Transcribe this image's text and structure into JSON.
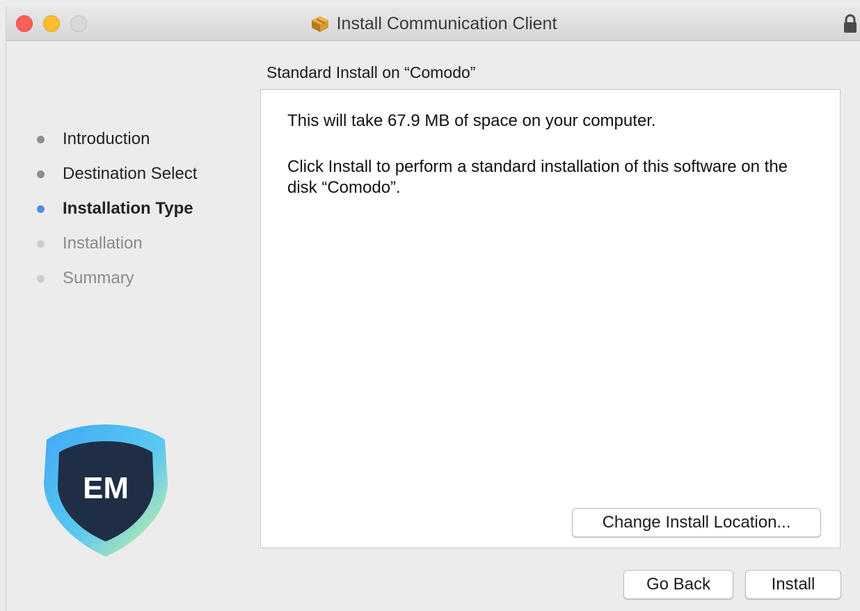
{
  "window": {
    "title": "Install Communication Client",
    "title_icon": "package-icon",
    "lock_icon": "lock-icon"
  },
  "subtitle": "Standard Install on “Comodo”",
  "steps": [
    {
      "label": "Introduction",
      "state": "done"
    },
    {
      "label": "Destination Select",
      "state": "done"
    },
    {
      "label": "Installation Type",
      "state": "active"
    },
    {
      "label": "Installation",
      "state": "pending"
    },
    {
      "label": "Summary",
      "state": "pending"
    }
  ],
  "logo": {
    "text": "EM",
    "icon": "em-shield-logo"
  },
  "content": {
    "space_message": "This will take 67.9 MB of space on your computer.",
    "install_message": "Click Install to perform a standard installation of this software on the disk “Comodo”."
  },
  "buttons": {
    "change_location": "Change Install Location...",
    "go_back": "Go Back",
    "install": "Install"
  },
  "colors": {
    "active_step": "#4a90e2",
    "close": "#fc5f57",
    "minimize": "#fdbc2e",
    "logo_dark": "#1f2d45",
    "logo_blue": "#3fa9f5",
    "logo_green": "#c9f08a"
  }
}
